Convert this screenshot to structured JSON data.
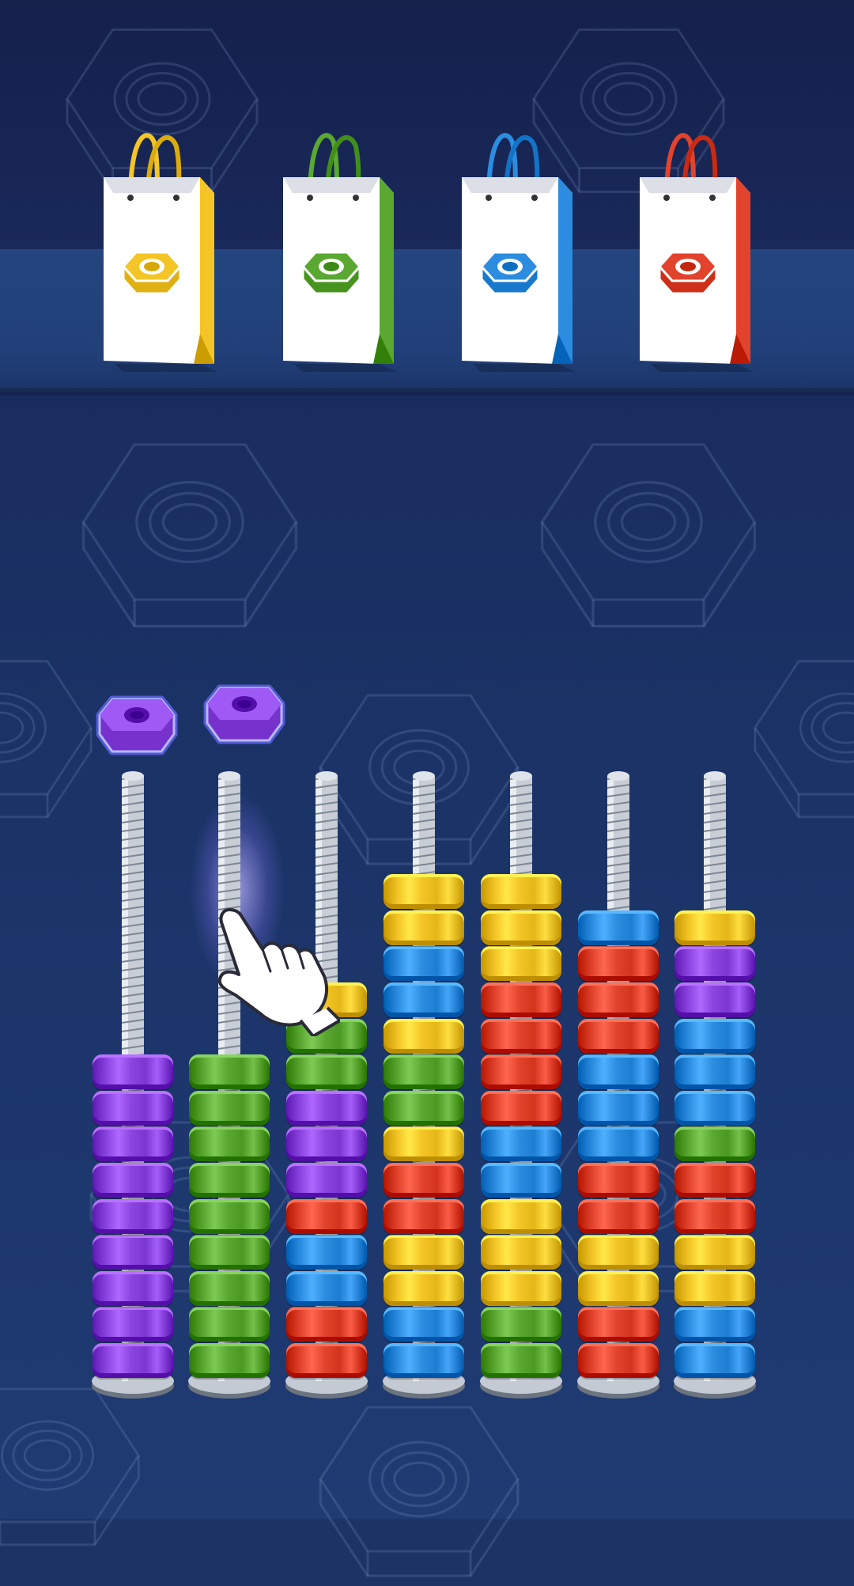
{
  "scene": "nut-sort-puzzle",
  "colors": {
    "purple": "#8b45e0",
    "green": "#5aa832",
    "yellow": "#f4c526",
    "blue": "#2c8ce0",
    "red": "#e2432c",
    "background": "#1d3366",
    "shelf": "#22427d"
  },
  "bags": [
    {
      "color": "yellow",
      "icon": "hex-nut-icon"
    },
    {
      "color": "green",
      "icon": "hex-nut-icon"
    },
    {
      "color": "blue",
      "icon": "hex-nut-icon"
    },
    {
      "color": "red",
      "icon": "hex-nut-icon"
    }
  ],
  "lifted_nuts": [
    "purple",
    "purple"
  ],
  "bolts": [
    {
      "nuts": [
        "purple",
        "purple",
        "purple",
        "purple",
        "purple",
        "purple",
        "purple",
        "purple",
        "purple"
      ]
    },
    {
      "nuts": [
        "green",
        "green",
        "green",
        "green",
        "green",
        "green",
        "green",
        "green",
        "green"
      ]
    },
    {
      "nuts": [
        "red",
        "red",
        "blue",
        "blue",
        "red",
        "purple",
        "purple",
        "purple",
        "green",
        "green",
        "yellow"
      ]
    },
    {
      "nuts": [
        "blue",
        "blue",
        "yellow",
        "yellow",
        "red",
        "red",
        "yellow",
        "green",
        "green",
        "yellow",
        "blue",
        "blue",
        "yellow",
        "yellow"
      ]
    },
    {
      "nuts": [
        "green",
        "green",
        "yellow",
        "yellow",
        "yellow",
        "blue",
        "blue",
        "red",
        "red",
        "red",
        "red",
        "yellow",
        "yellow",
        "yellow"
      ]
    },
    {
      "nuts": [
        "red",
        "red",
        "yellow",
        "yellow",
        "red",
        "red",
        "blue",
        "blue",
        "blue",
        "red",
        "red",
        "red",
        "blue"
      ]
    },
    {
      "nuts": [
        "blue",
        "blue",
        "yellow",
        "yellow",
        "red",
        "red",
        "green",
        "blue",
        "blue",
        "blue",
        "purple",
        "purple",
        "yellow"
      ]
    }
  ],
  "hint": {
    "icon": "pointing-hand-icon",
    "target_bolt": 1
  }
}
